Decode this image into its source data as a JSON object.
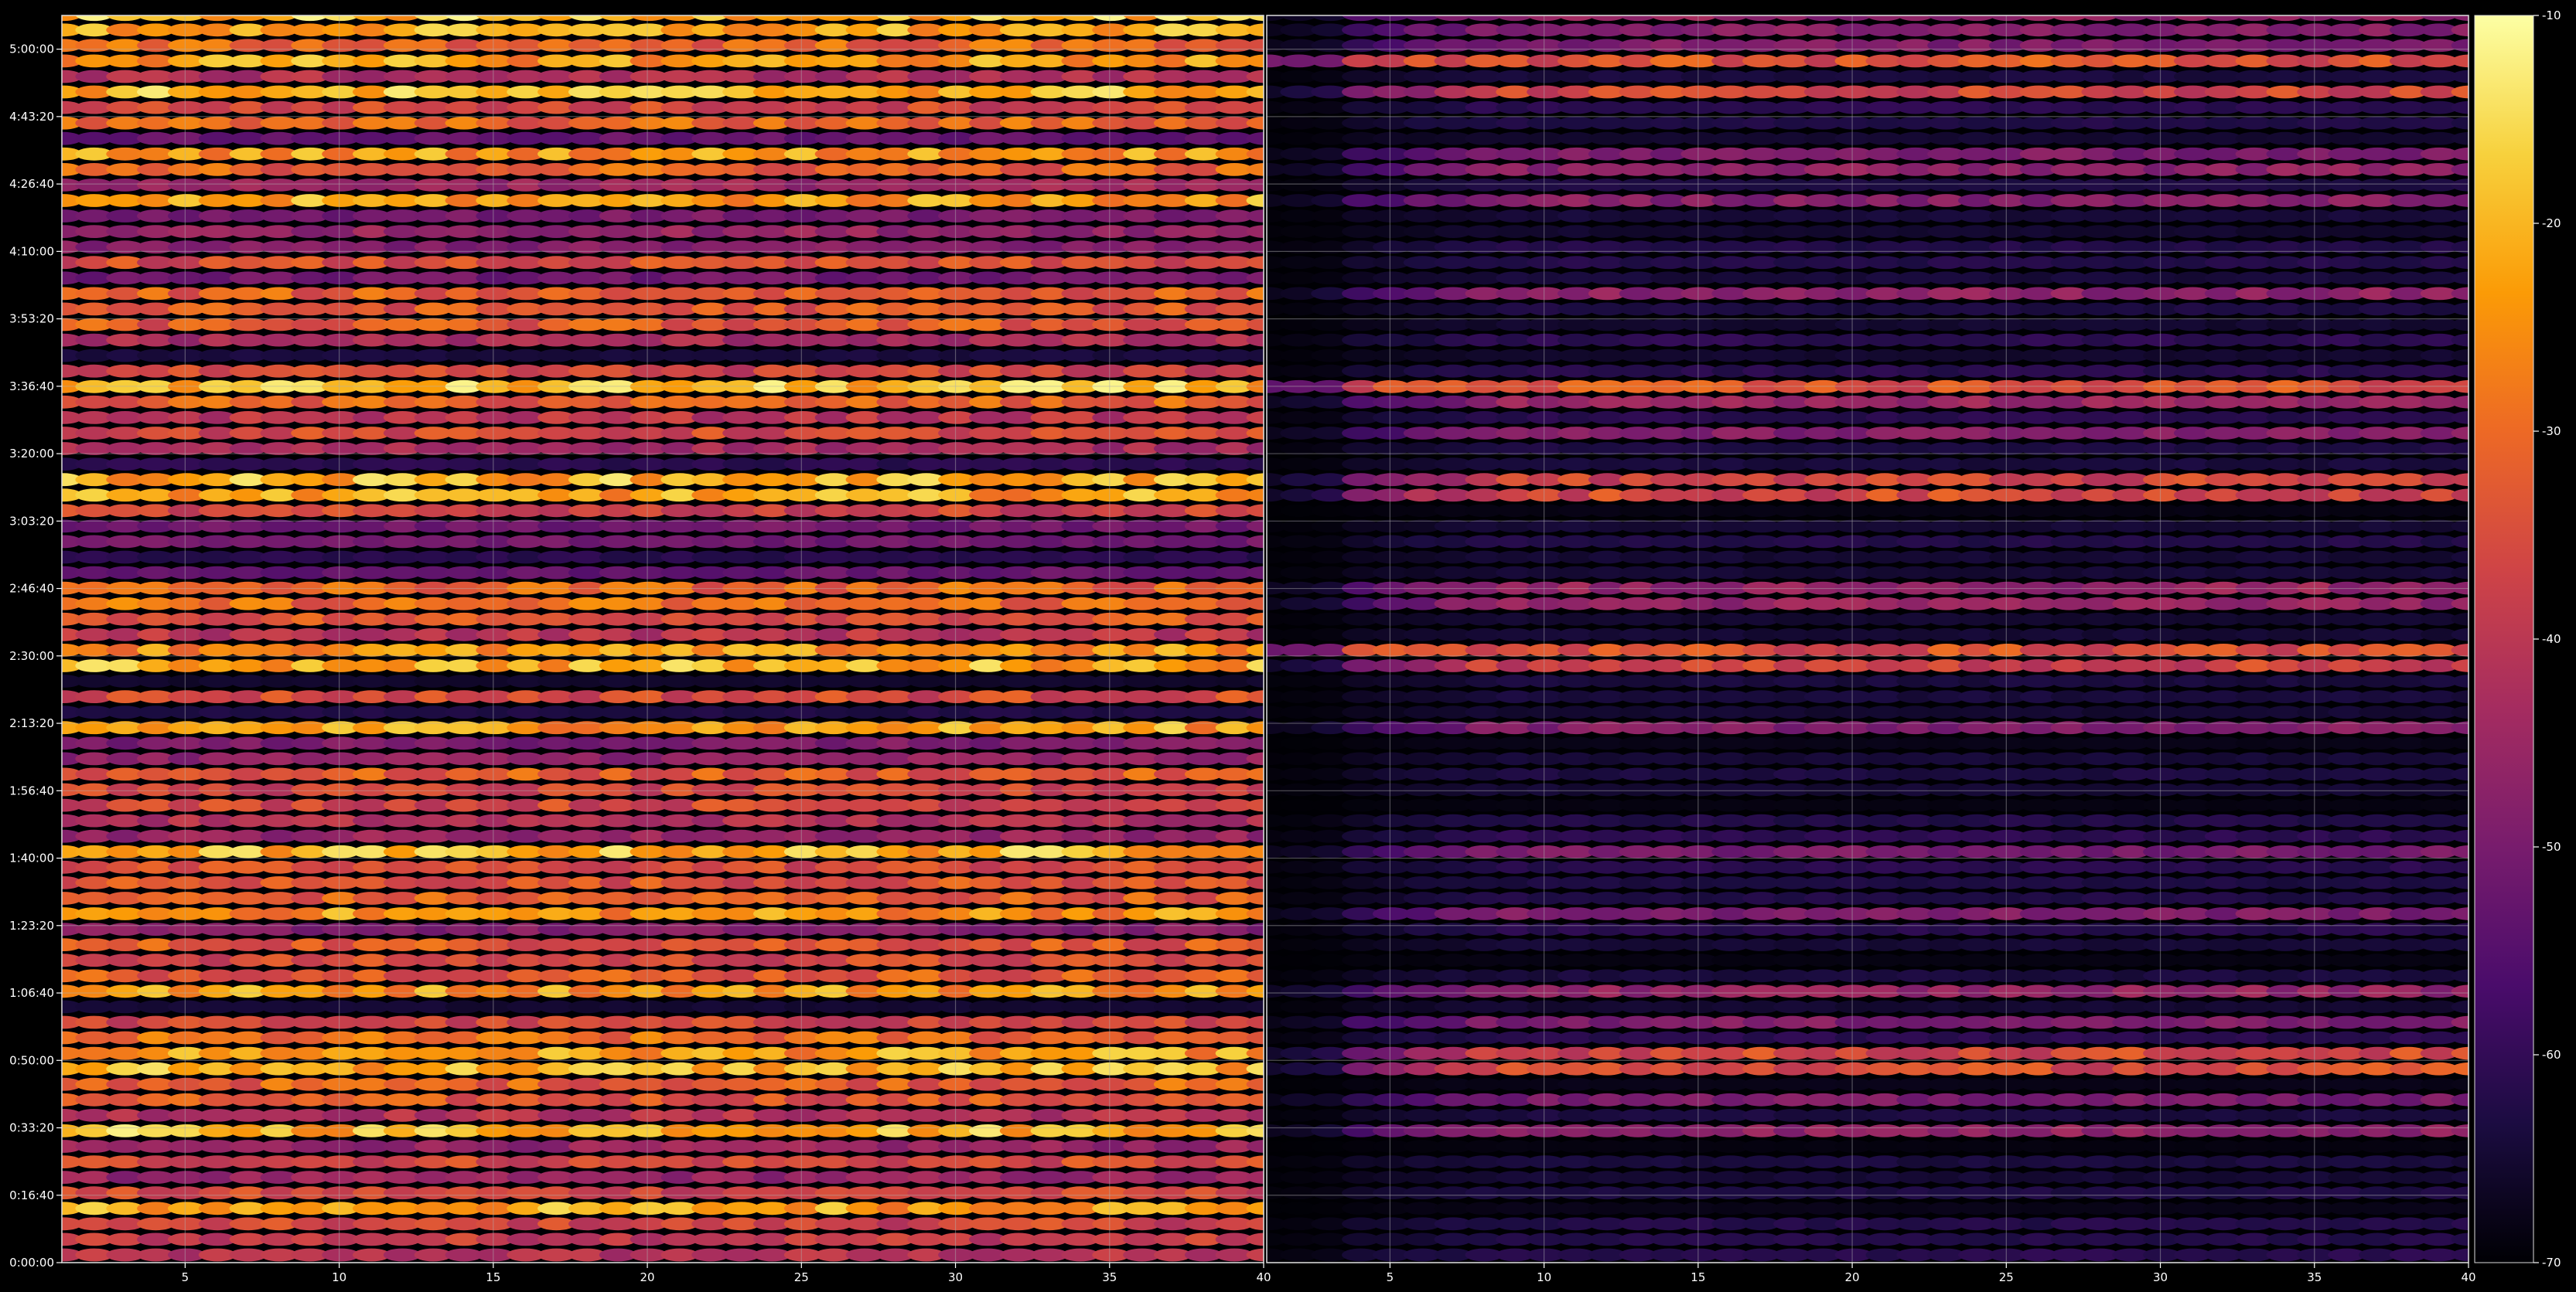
{
  "chart_data": [
    {
      "type": "heatmap",
      "panel": "left",
      "x_ticks": [
        "5",
        "10",
        "15",
        "20",
        "25",
        "30",
        "35",
        "40"
      ],
      "x_tick_values": [
        5,
        10,
        15,
        20,
        25,
        30,
        35,
        40
      ],
      "xlim": [
        1,
        40
      ],
      "y_ticks": [
        "0:00:00",
        "0:16:40",
        "0:33:20",
        "0:50:00",
        "1:06:40",
        "1:23:20",
        "1:40:00",
        "1:56:40",
        "2:13:20",
        "2:30:00",
        "2:46:40",
        "3:03:20",
        "3:20:00",
        "3:36:40",
        "3:53:20",
        "4:10:00",
        "4:26:40",
        "4:43:20",
        "5:00:00"
      ],
      "y_tick_values_seconds": [
        0,
        1000,
        2000,
        3000,
        4000,
        5000,
        6000,
        7000,
        8000,
        9000,
        10000,
        11000,
        12000,
        13000,
        14000,
        15000,
        16000,
        17000,
        18000
      ],
      "ylim_seconds": [
        0,
        18500
      ],
      "grid": true,
      "bright_rows_seconds": [
        18420,
        17900,
        17400,
        16450,
        15700,
        13050,
        11500,
        8990,
        7960,
        6130,
        5180,
        3960,
        3000,
        1920,
        800
      ],
      "mid_rows_seconds": [
        18100,
        17150,
        16900,
        16200,
        14850,
        14400,
        14050,
        12700,
        12250,
        11250,
        9900,
        9500,
        8800,
        8350,
        7300,
        6900,
        5900,
        5500,
        4700,
        4300,
        3650,
        3300,
        2750,
        2450,
        1500,
        1100,
        500
      ],
      "value_range_db": [
        -70,
        -10
      ]
    },
    {
      "type": "heatmap",
      "panel": "right",
      "x_ticks": [
        "5",
        "10",
        "15",
        "20",
        "25",
        "30",
        "35",
        "40"
      ],
      "x_tick_values": [
        5,
        10,
        15,
        20,
        25,
        30,
        35,
        40
      ],
      "xlim": [
        1,
        40
      ],
      "ylim_seconds": [
        0,
        18500
      ],
      "grid": true,
      "bright_rows_seconds": [
        17900,
        17400,
        13050,
        11500,
        8990,
        3000
      ],
      "mid_rows_seconds": [
        18420,
        18100,
        16450,
        16200,
        15700,
        14400,
        12700,
        12250,
        9900,
        7960,
        6130,
        5180,
        3960,
        3650,
        2450,
        1920
      ],
      "value_range_db": [
        -70,
        -10
      ]
    }
  ],
  "colorbar": {
    "ticks": [
      "-10",
      "-20",
      "-30",
      "-40",
      "-50",
      "-60",
      "-70"
    ],
    "tick_values": [
      -10,
      -20,
      -30,
      -40,
      -50,
      -60,
      -70
    ],
    "range": [
      -70,
      -10
    ],
    "colormap": "inferno",
    "stops": [
      "#000004",
      "#1b0c41",
      "#4a0c6b",
      "#781c6d",
      "#a52c60",
      "#cf4446",
      "#ed6925",
      "#fb9b06",
      "#f7d13d",
      "#fcffa4"
    ]
  }
}
